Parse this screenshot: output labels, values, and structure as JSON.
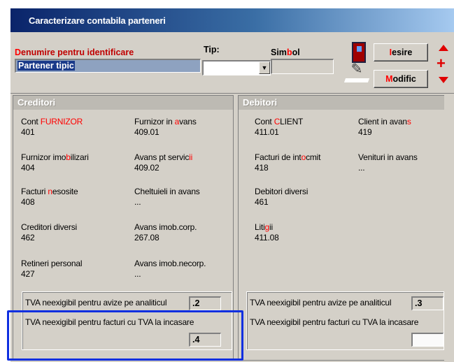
{
  "window": {
    "title": "Caracterizare contabila parteneri"
  },
  "form": {
    "denumire_label_hot": "D",
    "denumire_label_rest": "enumire pentru identificare",
    "denumire_value": "Partener tipic",
    "tip_label": "Tip:",
    "tip_value": "",
    "simbol_label_pre": "Sim",
    "simbol_label_hot": "b",
    "simbol_label_post": "ol",
    "simbol_value": ""
  },
  "buttons": {
    "iesire_hot": "I",
    "iesire_rest": "esire",
    "modific_hot": "M",
    "modific_rest": "odific"
  },
  "creditori": {
    "title": "Creditori",
    "items": [
      {
        "pre": "Cont ",
        "hot": "FURNIZOR",
        "post": "",
        "code": "401"
      },
      {
        "pre": "Furnizor in ",
        "hot": "a",
        "post": "vans",
        "code": "409.01"
      },
      {
        "pre": "Furnizor imo",
        "hot": "b",
        "post": "ilizari",
        "code": "404"
      },
      {
        "pre": "Avans pt servic",
        "hot": "ii",
        "post": "",
        "code": "409.02"
      },
      {
        "pre": "Facturi ",
        "hot": "n",
        "post": "esosite",
        "code": "408"
      },
      {
        "pre": "Cheltuieli in avans",
        "hot": "",
        "post": "",
        "code": "..."
      },
      {
        "pre": "Creditori diversi",
        "hot": "",
        "post": "",
        "code": "462"
      },
      {
        "pre": "Avans imob.corp.",
        "hot": "",
        "post": "",
        "code": "267.08"
      },
      {
        "pre": "Retineri personal",
        "hot": "",
        "post": "",
        "code": "427"
      },
      {
        "pre": "Avans imob.necorp.",
        "hot": "",
        "post": "",
        "code": "..."
      }
    ],
    "tva_avize_label": "TVA neexigibil pentru avize pe analiticul",
    "tva_avize_value": ".2",
    "tva_facturi_label": "TVA neexigibil pentru facturi cu TVA la incasare",
    "tva_facturi_value": ".4"
  },
  "debitori": {
    "title": "Debitori",
    "items": [
      {
        "pre": "Cont ",
        "hot": "C",
        "post": "LIENT",
        "code": "411.01"
      },
      {
        "pre": "Client in avan",
        "hot": "s",
        "post": "",
        "code": "419"
      },
      {
        "pre": "Facturi de int",
        "hot": "o",
        "post": "cmit",
        "code": "418"
      },
      {
        "pre": "Venituri in avans",
        "hot": "",
        "post": "",
        "code": "..."
      },
      {
        "pre": "Debitori diversi",
        "hot": "",
        "post": "",
        "code": "461"
      },
      {
        "pre": "Liti",
        "hot": "g",
        "post": "ii",
        "code": "411.08"
      }
    ],
    "tva_avize_label": "TVA neexigibil pentru avize pe analiticul",
    "tva_avize_value": ".3",
    "tva_facturi_label": "TVA neexigibil pentru facturi cu TVA la incasare",
    "tva_facturi_value": ""
  },
  "icons": [
    "exit-door-icon",
    "edit-pen-icon",
    "nav-up-icon",
    "nav-add-icon",
    "nav-down-icon"
  ],
  "colors": {
    "title_bar": "#0a246a",
    "hotkey": "#ff0000",
    "highlight": "#0f2fe0"
  }
}
